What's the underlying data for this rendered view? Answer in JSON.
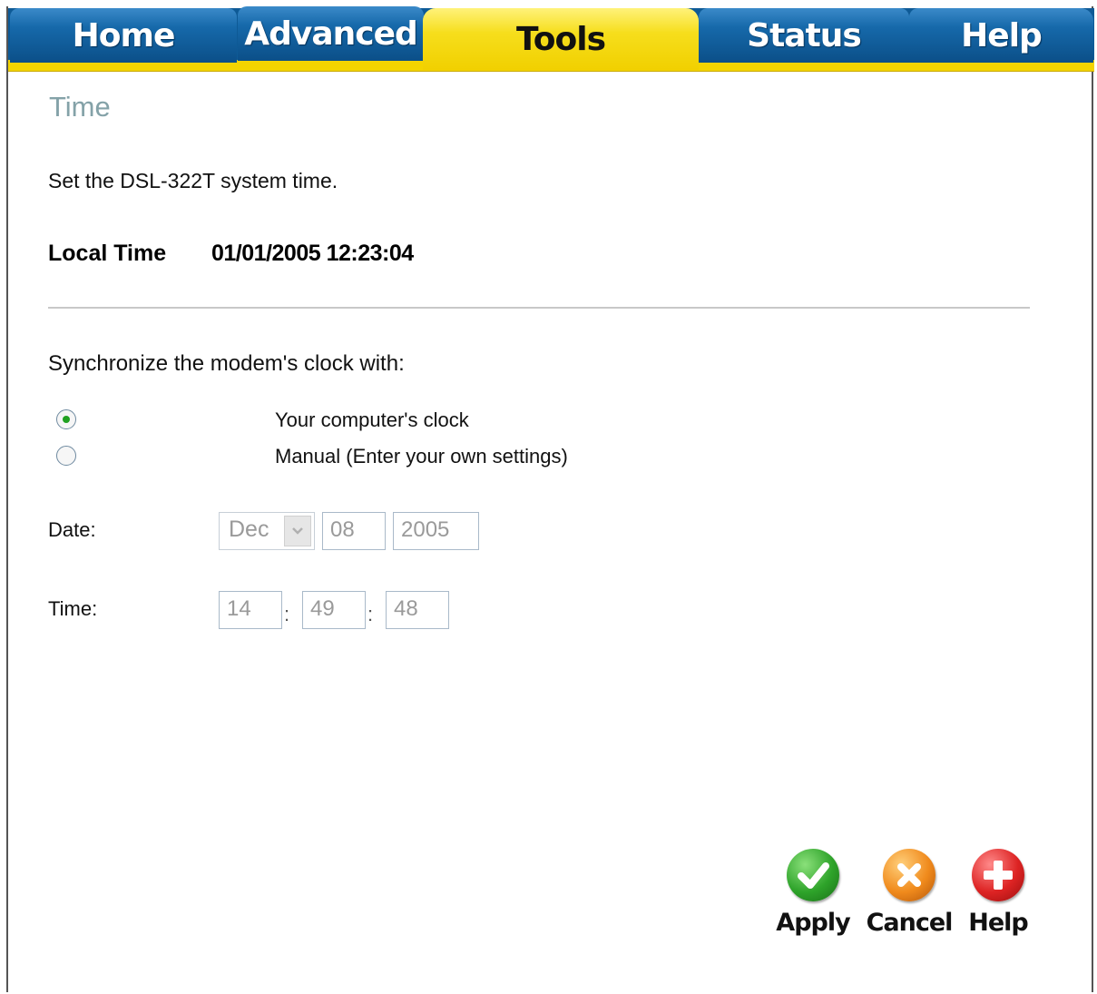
{
  "nav": {
    "tabs": [
      {
        "label": "Home"
      },
      {
        "label": "Advanced"
      },
      {
        "label": "Tools",
        "active": true
      },
      {
        "label": "Status"
      },
      {
        "label": "Help"
      }
    ]
  },
  "page": {
    "title": "Time",
    "description": "Set the DSL-322T system time.",
    "local_time_label": "Local Time",
    "local_time_value": "01/01/2005 12:23:04"
  },
  "sync": {
    "label": "Synchronize the modem's clock with:",
    "options": [
      {
        "label": "Your computer's clock",
        "selected": true
      },
      {
        "label": "Manual (Enter your own settings)",
        "selected": false
      }
    ]
  },
  "date": {
    "label": "Date:",
    "month": "Dec",
    "day": "08",
    "year": "2005"
  },
  "time": {
    "label": "Time:",
    "hour": "14",
    "minute": "49",
    "second": "48",
    "separator": ":"
  },
  "actions": {
    "apply_label": "Apply",
    "cancel_label": "Cancel",
    "help_label": "Help"
  },
  "colors": {
    "nav_blue": "#0e5a96",
    "nav_yellow": "#f3d400",
    "title_color": "#84a2a8",
    "radio_selected": "#21a121"
  },
  "icons": {
    "apply": "checkmark-icon",
    "cancel": "x-icon",
    "help": "plus-icon",
    "dropdown": "chevron-down-icon"
  }
}
